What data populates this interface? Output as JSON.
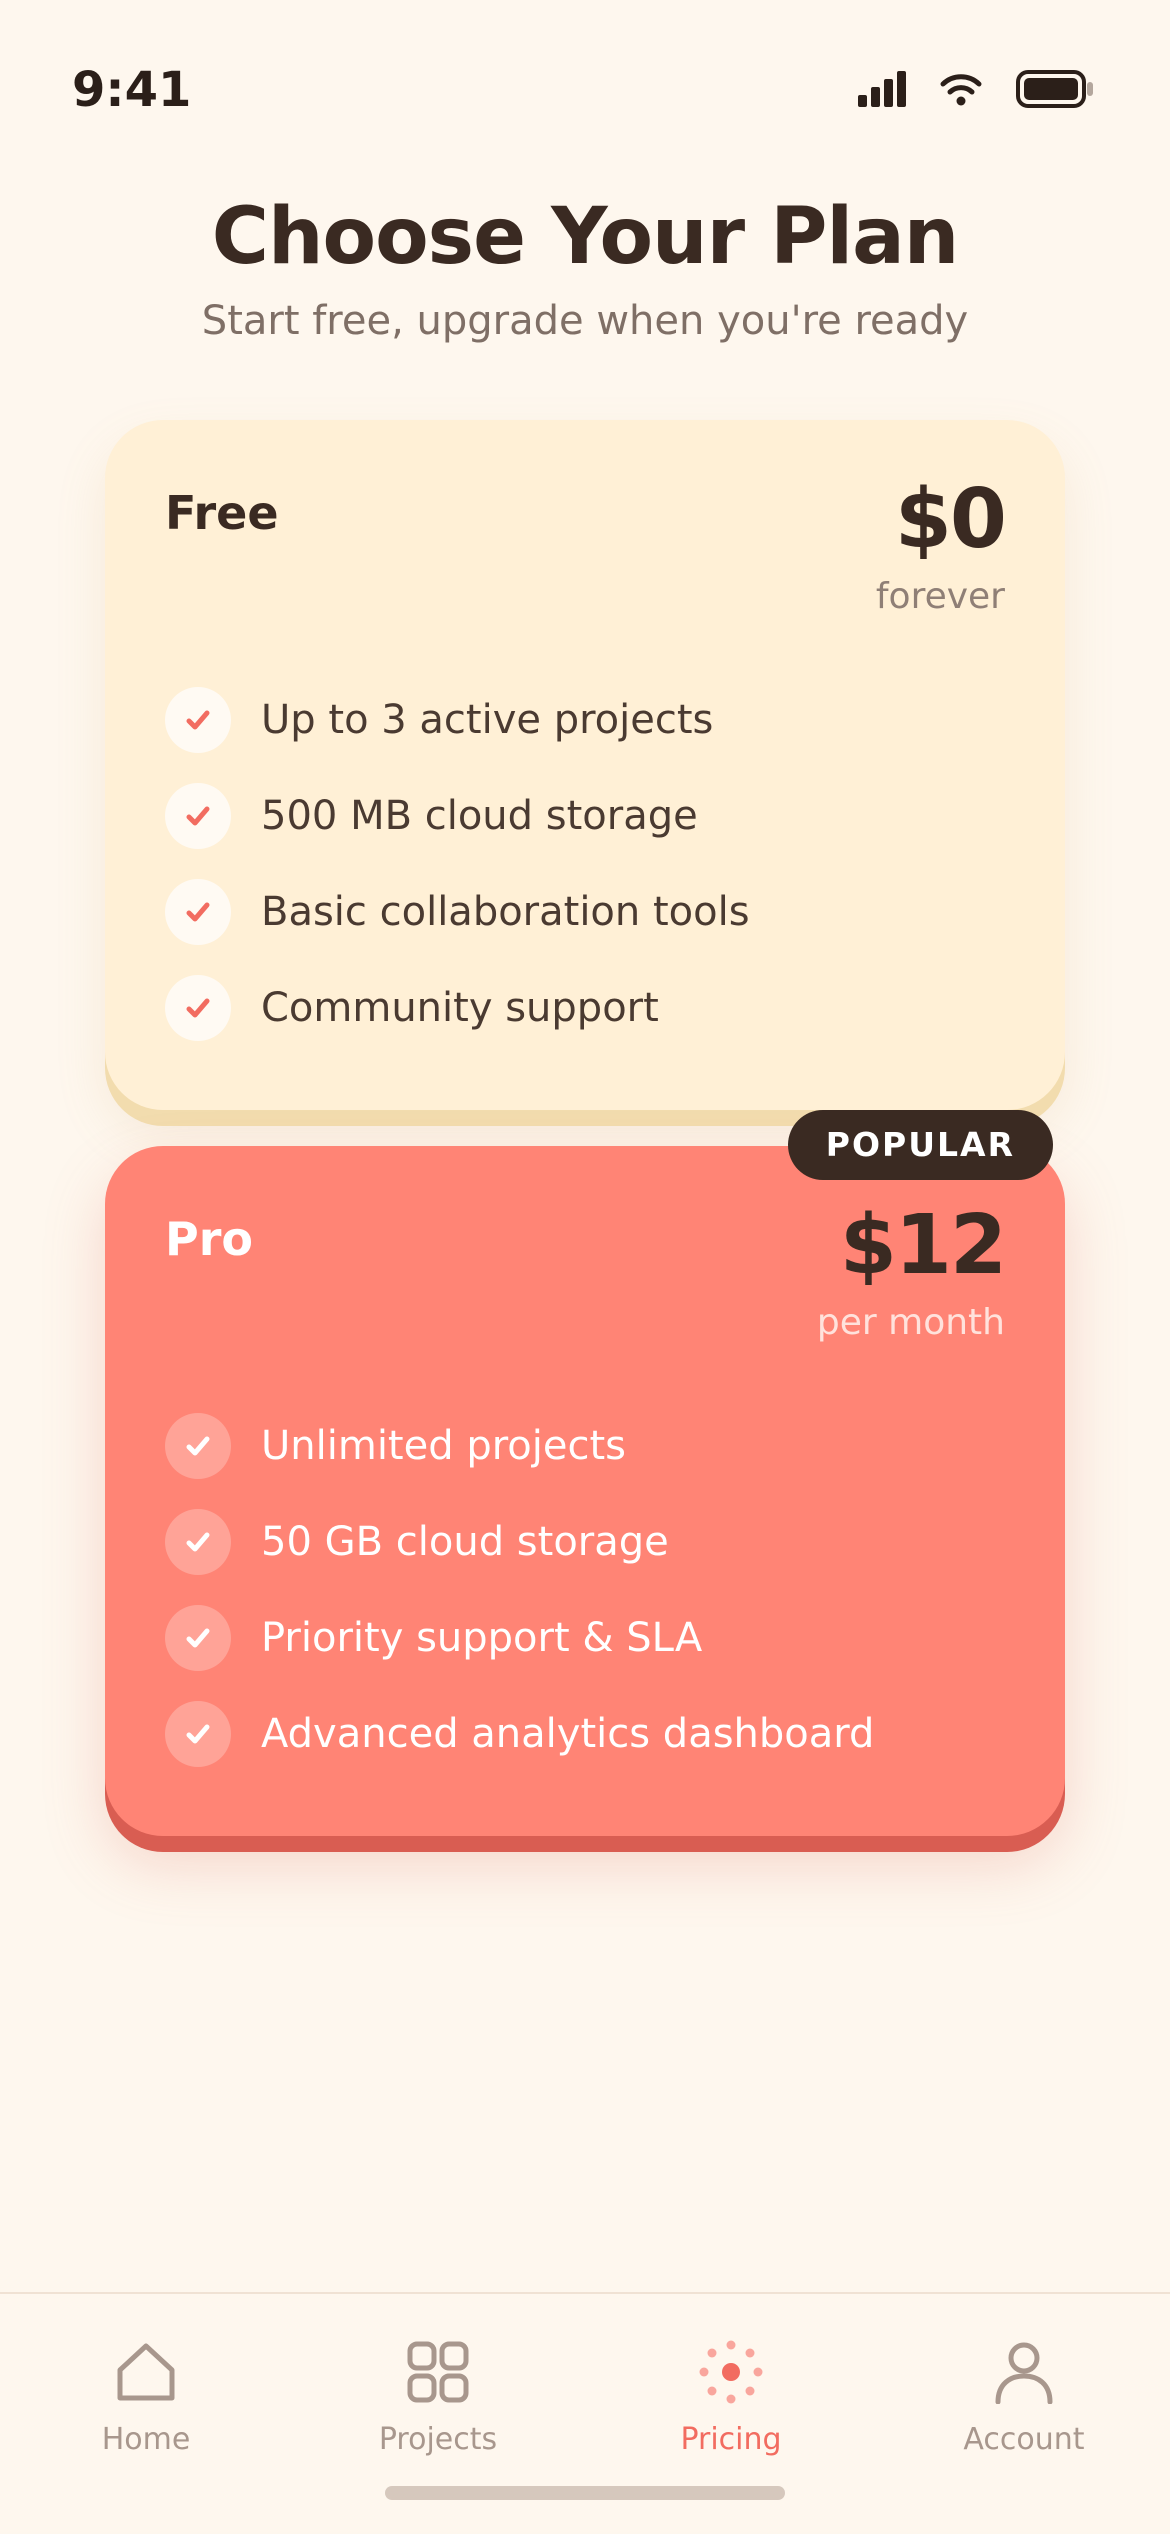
{
  "status_bar": {
    "time": "9:41",
    "icons": [
      "signal-icon",
      "wifi-icon",
      "battery-icon"
    ]
  },
  "header": {
    "title": "Choose Your Plan",
    "subtitle": "Start free, upgrade when you're ready"
  },
  "plans": [
    {
      "name": "Free",
      "price": "$0",
      "period": "forever",
      "features": [
        "Up to 3 active projects",
        "500 MB cloud storage",
        "Basic collaboration tools",
        "Community support"
      ]
    },
    {
      "name": "Pro",
      "price": "$12",
      "period": "per month",
      "badge": "POPULAR",
      "features": [
        "Unlimited projects",
        "50 GB cloud storage",
        "Priority support & SLA",
        "Advanced analytics dashboard"
      ]
    }
  ],
  "tab_bar": {
    "active": "Pricing",
    "tabs": [
      {
        "label": "Home",
        "icon": "home-icon"
      },
      {
        "label": "Projects",
        "icon": "grid-icon"
      },
      {
        "label": "Pricing",
        "icon": "sparkle-icon"
      },
      {
        "label": "Account",
        "icon": "person-icon"
      }
    ]
  },
  "colors": {
    "background": "#fef7ee",
    "free_card": "#fff0d6",
    "pro_card": "#ff8475",
    "accent": "#f26c60",
    "dark": "#3a2a22",
    "inactive_tab": "#a8978d"
  }
}
